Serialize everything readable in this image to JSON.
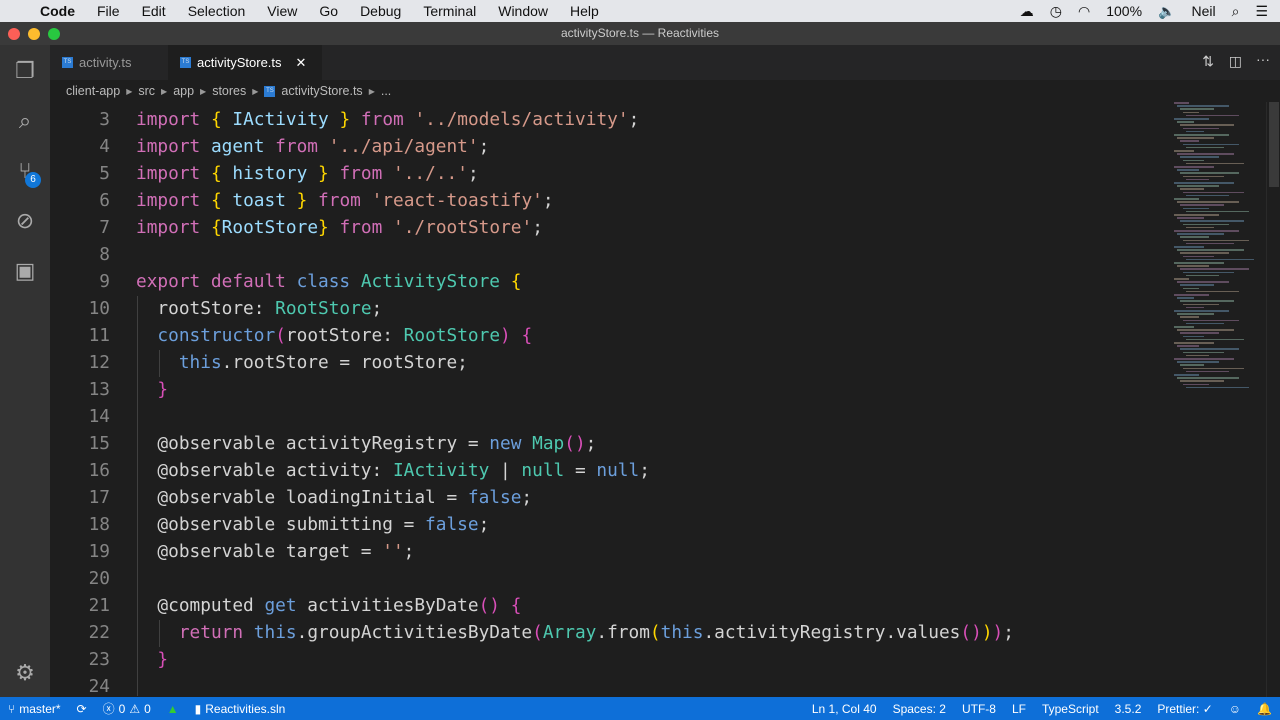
{
  "menubar": {
    "app": "Code",
    "items": [
      "File",
      "Edit",
      "Selection",
      "View",
      "Go",
      "Debug",
      "Terminal",
      "Window",
      "Help"
    ],
    "battery": "100%",
    "user": "Neil"
  },
  "window": {
    "title": "activityStore.ts — Reactivities"
  },
  "activity_bar": {
    "scm_badge": "6"
  },
  "tabs": [
    {
      "label": "activity.ts",
      "active": false
    },
    {
      "label": "activityStore.ts",
      "active": true
    }
  ],
  "breadcrumbs": [
    "client-app",
    "src",
    "app",
    "stores",
    "activityStore.ts",
    "..."
  ],
  "editor": {
    "lines": [
      {
        "n": "3",
        "t": [
          [
            "import",
            "kw"
          ],
          [
            " ",
            "pl"
          ],
          [
            "{",
            "br"
          ],
          [
            " ",
            "pl"
          ],
          [
            "IActivity",
            "vr"
          ],
          [
            " ",
            "pl"
          ],
          [
            "}",
            "br"
          ],
          [
            " ",
            "pl"
          ],
          [
            "from",
            "kw"
          ],
          [
            " ",
            "pl"
          ],
          [
            "'../models/activity'",
            "str"
          ],
          [
            ";",
            "pl"
          ]
        ]
      },
      {
        "n": "4",
        "t": [
          [
            "import",
            "kw"
          ],
          [
            " agent ",
            "vr"
          ],
          [
            "from",
            "kw"
          ],
          [
            " ",
            "pl"
          ],
          [
            "'../api/agent'",
            "str"
          ],
          [
            ";",
            "pl"
          ]
        ]
      },
      {
        "n": "5",
        "t": [
          [
            "import",
            "kw"
          ],
          [
            " ",
            "pl"
          ],
          [
            "{",
            "br"
          ],
          [
            " history ",
            "vr"
          ],
          [
            "}",
            "br"
          ],
          [
            " ",
            "pl"
          ],
          [
            "from",
            "kw"
          ],
          [
            " ",
            "pl"
          ],
          [
            "'../..'",
            "str"
          ],
          [
            ";",
            "pl"
          ]
        ]
      },
      {
        "n": "6",
        "t": [
          [
            "import",
            "kw"
          ],
          [
            " ",
            "pl"
          ],
          [
            "{",
            "br"
          ],
          [
            " toast ",
            "vr"
          ],
          [
            "}",
            "br"
          ],
          [
            " ",
            "pl"
          ],
          [
            "from",
            "kw"
          ],
          [
            " ",
            "pl"
          ],
          [
            "'react-toastify'",
            "str"
          ],
          [
            ";",
            "pl"
          ]
        ]
      },
      {
        "n": "7",
        "t": [
          [
            "import",
            "kw"
          ],
          [
            " ",
            "pl"
          ],
          [
            "{",
            "br"
          ],
          [
            "RootStore",
            "vr"
          ],
          [
            "}",
            "br"
          ],
          [
            " ",
            "pl"
          ],
          [
            "from",
            "kw"
          ],
          [
            " ",
            "pl"
          ],
          [
            "'./rootStore'",
            "str"
          ],
          [
            ";",
            "pl"
          ]
        ]
      },
      {
        "n": "8",
        "t": []
      },
      {
        "n": "9",
        "t": [
          [
            "export default",
            "kw"
          ],
          [
            " ",
            "pl"
          ],
          [
            "class",
            "st"
          ],
          [
            " ",
            "pl"
          ],
          [
            "ActivityStore",
            "ty"
          ],
          [
            " ",
            "pl"
          ],
          [
            "{",
            "br"
          ]
        ]
      },
      {
        "n": "10",
        "t": [
          [
            "  rootStore: ",
            "pl"
          ],
          [
            "RootStore",
            "ty"
          ],
          [
            ";",
            "pl"
          ]
        ]
      },
      {
        "n": "11",
        "t": [
          [
            "  ",
            "pl"
          ],
          [
            "constructor",
            "st"
          ],
          [
            "(",
            "pr"
          ],
          [
            "rootStore: ",
            "pl"
          ],
          [
            "RootStore",
            "ty"
          ],
          [
            ")",
            "pr"
          ],
          [
            " ",
            "pl"
          ],
          [
            "{",
            "pr"
          ]
        ]
      },
      {
        "n": "12",
        "t": [
          [
            "    ",
            "pl"
          ],
          [
            "this",
            "st"
          ],
          [
            ".rootStore = rootStore;",
            "pl"
          ]
        ]
      },
      {
        "n": "13",
        "t": [
          [
            "  ",
            "pl"
          ],
          [
            "}",
            "pr"
          ]
        ]
      },
      {
        "n": "14",
        "t": []
      },
      {
        "n": "15",
        "t": [
          [
            "  @observable activityRegistry = ",
            "pl"
          ],
          [
            "new",
            "st"
          ],
          [
            " ",
            "pl"
          ],
          [
            "Map",
            "ty"
          ],
          [
            "()",
            "pr"
          ],
          [
            ";",
            "pl"
          ]
        ]
      },
      {
        "n": "16",
        "t": [
          [
            "  @observable activity: ",
            "pl"
          ],
          [
            "IActivity",
            "ty"
          ],
          [
            " | ",
            "pl"
          ],
          [
            "null",
            "ty"
          ],
          [
            " = ",
            "pl"
          ],
          [
            "null",
            "st"
          ],
          [
            ";",
            "pl"
          ]
        ]
      },
      {
        "n": "17",
        "t": [
          [
            "  @observable loadingInitial = ",
            "pl"
          ],
          [
            "false",
            "st"
          ],
          [
            ";",
            "pl"
          ]
        ]
      },
      {
        "n": "18",
        "t": [
          [
            "  @observable submitting = ",
            "pl"
          ],
          [
            "false",
            "st"
          ],
          [
            ";",
            "pl"
          ]
        ]
      },
      {
        "n": "19",
        "t": [
          [
            "  @observable target = ",
            "pl"
          ],
          [
            "''",
            "str"
          ],
          [
            ";",
            "pl"
          ]
        ]
      },
      {
        "n": "20",
        "t": []
      },
      {
        "n": "21",
        "t": [
          [
            "  @computed ",
            "pl"
          ],
          [
            "get",
            "st"
          ],
          [
            " activitiesByDate",
            "pl"
          ],
          [
            "()",
            "pr"
          ],
          [
            " ",
            "pl"
          ],
          [
            "{",
            "pr"
          ]
        ]
      },
      {
        "n": "22",
        "t": [
          [
            "    ",
            "pl"
          ],
          [
            "return",
            "kw"
          ],
          [
            " ",
            "pl"
          ],
          [
            "this",
            "st"
          ],
          [
            ".groupActivitiesByDate",
            "pl"
          ],
          [
            "(",
            "pr"
          ],
          [
            "Array",
            "ty"
          ],
          [
            ".from",
            "pl"
          ],
          [
            "(",
            "br"
          ],
          [
            "this",
            "st"
          ],
          [
            ".activityRegistry.values",
            "pl"
          ],
          [
            "()",
            "pr"
          ],
          [
            ")",
            "br"
          ],
          [
            ")",
            "pr"
          ],
          [
            ";",
            "pl"
          ]
        ]
      },
      {
        "n": "23",
        "t": [
          [
            "  ",
            "pl"
          ],
          [
            "}",
            "pr"
          ]
        ]
      },
      {
        "n": "24",
        "t": []
      }
    ]
  },
  "status": {
    "branch": "master*",
    "errors": "0",
    "warnings": "0",
    "solution": "Reactivities.sln",
    "position": "Ln 1, Col 40",
    "spaces": "Spaces: 2",
    "encoding": "UTF-8",
    "eol": "LF",
    "language": "TypeScript",
    "version": "3.5.2",
    "prettier": "Prettier: ✓"
  },
  "colors": {
    "status": "#0e6fd8",
    "activity_bar": "#333333",
    "editor": "#1e1e1e"
  }
}
